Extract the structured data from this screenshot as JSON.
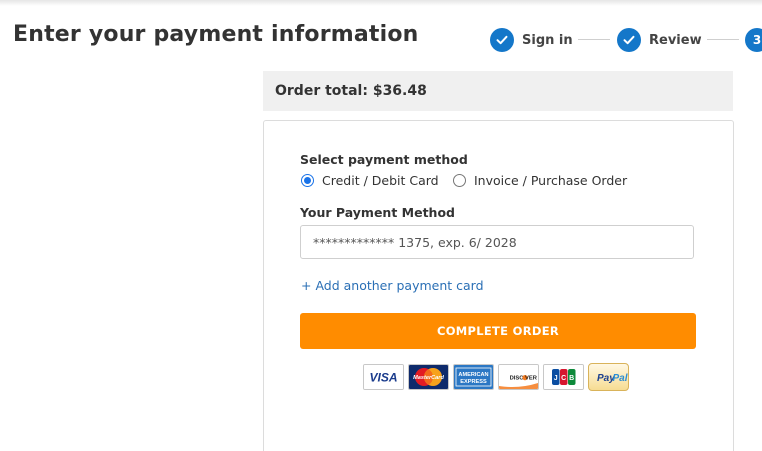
{
  "page": {
    "title": "Enter your payment information"
  },
  "stepper": {
    "steps": [
      {
        "label": "Sign in",
        "state": "done"
      },
      {
        "label": "Review",
        "state": "done"
      },
      {
        "label": "",
        "number": "3",
        "state": "current"
      }
    ]
  },
  "order": {
    "total_label": "Order total: $36.48"
  },
  "payment": {
    "select_method_label": "Select payment method",
    "methods": [
      {
        "label": "Credit / Debit Card",
        "selected": true
      },
      {
        "label": "Invoice / Purchase Order",
        "selected": false
      }
    ],
    "your_method_label": "Your Payment Method",
    "selected_card": "************* 1375, exp. 6/ 2028",
    "add_card_link": "+ Add another payment card",
    "complete_button": "COMPLETE ORDER",
    "card_logos": [
      "visa-logo",
      "mastercard-logo",
      "american-express-logo",
      "discover-logo",
      "jcb-logo",
      "paypal-logo"
    ]
  },
  "colors": {
    "accent_blue": "#1477c9",
    "button_orange": "#ff8c00",
    "link_blue": "#2a6fb5"
  }
}
